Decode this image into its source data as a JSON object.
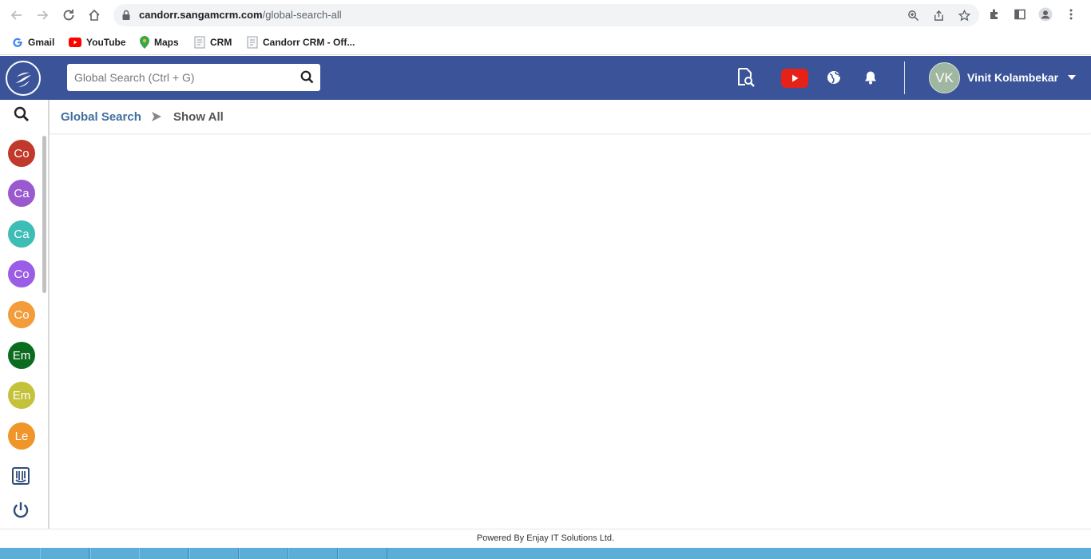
{
  "browser": {
    "url_host": "candorr.sangamcrm.com",
    "url_path": "/global-search-all"
  },
  "bookmarks": [
    {
      "label": "Gmail"
    },
    {
      "label": "YouTube"
    },
    {
      "label": "Maps"
    },
    {
      "label": "CRM"
    },
    {
      "label": "Candorr CRM - Off..."
    }
  ],
  "header": {
    "search_placeholder": "Global Search (Ctrl + G)",
    "user_initials": "VK",
    "user_name": "Vinit Kolambekar"
  },
  "sidebar": {
    "modules": [
      {
        "label": "Co",
        "color": "#c0392b"
      },
      {
        "label": "Ca",
        "color": "#9b59d0"
      },
      {
        "label": "Ca",
        "color": "#3dbdb5"
      },
      {
        "label": "Co",
        "color": "#9b5de5"
      },
      {
        "label": "Co",
        "color": "#f39c3c"
      },
      {
        "label": "Em",
        "color": "#0b6b1f"
      },
      {
        "label": "Em",
        "color": "#c3c23a"
      },
      {
        "label": "Le",
        "color": "#f0952a"
      }
    ]
  },
  "breadcrumb": {
    "parent": "Global Search",
    "current": "Show All"
  },
  "footer": {
    "text": "Powered By Enjay IT Solutions Ltd."
  },
  "colors": {
    "header_bg": "#3b5399",
    "breadcrumb_link": "#3f6fa0"
  }
}
